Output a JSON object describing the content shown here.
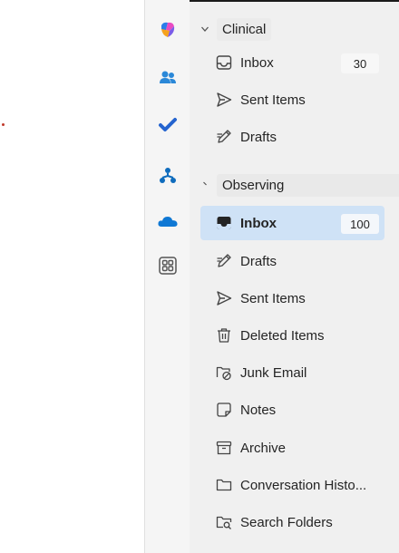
{
  "apps": [
    "copilot-icon",
    "people-icon",
    "todo-icon",
    "org-explorer-icon",
    "onedrive-icon",
    "more-apps-icon"
  ],
  "accounts": [
    {
      "name": "Clinical",
      "folders": [
        {
          "label": "Inbox",
          "count": "30",
          "icon": "inbox-icon"
        },
        {
          "label": "Sent Items",
          "icon": "send-icon"
        },
        {
          "label": "Drafts",
          "icon": "drafts-icon"
        }
      ]
    },
    {
      "name": "Observing",
      "folders": [
        {
          "label": "Inbox",
          "count": "100",
          "icon": "inbox-icon",
          "selected": true
        },
        {
          "label": "Drafts",
          "icon": "drafts-icon"
        },
        {
          "label": "Sent Items",
          "icon": "send-icon"
        },
        {
          "label": "Deleted Items",
          "icon": "trash-icon"
        },
        {
          "label": "Junk Email",
          "icon": "junk-icon"
        },
        {
          "label": "Notes",
          "icon": "notes-icon"
        },
        {
          "label": "Archive",
          "icon": "archive-icon"
        },
        {
          "label": "Conversation Histo...",
          "icon": "folder-icon"
        },
        {
          "label": "Search Folders",
          "icon": "search-folder-icon"
        }
      ]
    }
  ],
  "colors": {
    "selected": "#cfe2f6",
    "accent": "#0f6cbd"
  }
}
